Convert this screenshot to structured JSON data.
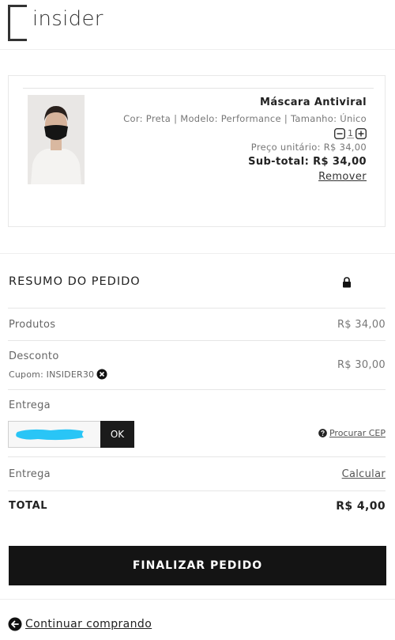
{
  "brand": {
    "logo_text": "insider"
  },
  "cart": {
    "product_name": "Máscara Antiviral",
    "variant": "Cor: Preta | Modelo: Performance | Tamanho: Único",
    "quantity": "1",
    "unit_price": "Preço unitário: R$ 34,00",
    "subtotal": "Sub-total: R$ 34,00",
    "remove_label": "Remover"
  },
  "summary": {
    "title": "RESUMO DO PEDIDO",
    "products_label": "Produtos",
    "products_value": "R$ 34,00",
    "discount_label": "Desconto",
    "discount_value": "R$ 30,00",
    "coupon_text": "Cupom: INSIDER30",
    "delivery_label": "Entrega",
    "cep_input_value": "",
    "ok_label": "OK",
    "find_cep_label": "Procurar CEP",
    "delivery2_label": "Entrega",
    "calculate_label": "Calcular",
    "total_label": "TOTAL",
    "total_value": "R$ 4,00"
  },
  "actions": {
    "finalize_label": "FINALIZAR PEDIDO",
    "continue_label": "Continuar comprando"
  },
  "icons": {
    "lock": "lock-icon",
    "remove_coupon": "close-circle-icon",
    "qty_minus": "minus-box-icon",
    "qty_plus": "plus-box-icon",
    "help": "question-circle-icon",
    "back": "arrow-left-circle-icon"
  },
  "colors": {
    "primary_button": "#141414",
    "redaction": "#29c5f6"
  }
}
